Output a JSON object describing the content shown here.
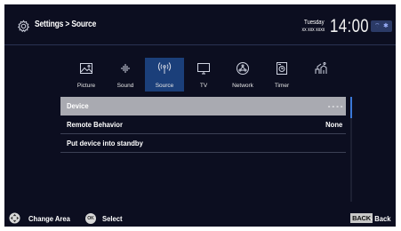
{
  "header": {
    "breadcrumb": "Settings > Source",
    "day": "Tuesday",
    "date": "xx xxx xxxx",
    "time": "14:00"
  },
  "tabs": [
    {
      "label": "Picture",
      "icon": "picture-icon"
    },
    {
      "label": "Sound",
      "icon": "sound-icon"
    },
    {
      "label": "Source",
      "icon": "source-icon",
      "active": true
    },
    {
      "label": "TV",
      "icon": "tv-icon"
    },
    {
      "label": "Network",
      "icon": "network-icon"
    },
    {
      "label": "Timer",
      "icon": "timer-icon"
    },
    {
      "label": "",
      "icon": "accessibility-icon"
    }
  ],
  "menu": {
    "rows": [
      {
        "label": "Device",
        "value": "- - - -"
      },
      {
        "label": "Remote Behavior",
        "value": "None"
      },
      {
        "label": "Put device into standby",
        "value": ""
      }
    ],
    "selected_index": 0
  },
  "footer": {
    "change_area": "Change Area",
    "ok_key": "OK",
    "select": "Select",
    "back_key": "BACK",
    "back": "- Back"
  },
  "colors": {
    "background": "#0c0e20",
    "active_tab": "#1b3f7a",
    "selected_row": "#a9aab1",
    "scroll_thumb": "#3a78d8"
  }
}
